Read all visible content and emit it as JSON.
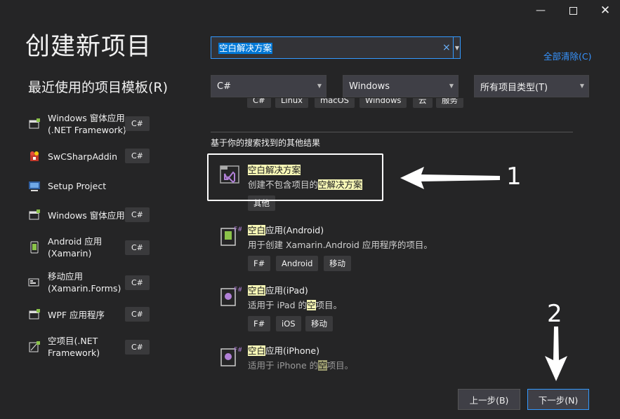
{
  "window": {
    "title": "创建新项目",
    "controls": [
      "minimize-icon",
      "maximize-icon",
      "close-icon"
    ]
  },
  "recent": {
    "header": "最近使用的项目模板(R)",
    "items": [
      {
        "label": "Windows 窗体应用 (.NET Framework)",
        "line1": "Windows 窗体应用",
        "line2": "(.NET Framework)",
        "lang": "C#",
        "icon": "winforms-icon"
      },
      {
        "label": "SwCSharpAddin",
        "line1": "SwCSharpAddin",
        "line2": "",
        "lang": "C#",
        "icon": "solidworks-addin-icon"
      },
      {
        "label": "Setup Project",
        "line1": "Setup Project",
        "line2": "",
        "lang": "",
        "icon": "setup-project-icon"
      },
      {
        "label": "Windows 窗体应用",
        "line1": "Windows 窗体应用",
        "line2": "",
        "lang": "C#",
        "icon": "winforms-icon"
      },
      {
        "label": "Android 应用 (Xamarin)",
        "line1": "Android 应用",
        "line2": "(Xamarin)",
        "lang": "C#",
        "icon": "android-app-icon"
      },
      {
        "label": "移动应用 (Xamarin.Forms)",
        "line1": "移动应用",
        "line2": "(Xamarin.Forms)",
        "lang": "C#",
        "icon": "mobile-app-icon"
      },
      {
        "label": "WPF 应用程序",
        "line1": "WPF 应用程序",
        "line2": "",
        "lang": "C#",
        "icon": "wpf-app-icon"
      },
      {
        "label": "空项目(.NET Framework)",
        "line1": "空项目(.NET",
        "line2": "Framework)",
        "lang": "C#",
        "icon": "empty-project-icon"
      }
    ]
  },
  "search": {
    "value": "空白解决方案",
    "clear_glyph": "×",
    "clear_all": "全部清除(C)"
  },
  "filters": {
    "language": "C#",
    "platform": "Windows",
    "project_type": "所有项目类型(T)"
  },
  "partial_tags": [
    "C#",
    "Linux",
    "macOS",
    "Windows",
    "云",
    "服务"
  ],
  "other_results_header": "基于你的搜索找到的其他结果",
  "results": [
    {
      "title_hl": "空白解决方案",
      "title_rest": "",
      "desc_pre": "创建不包含项目的",
      "desc_hl": "空解决方案",
      "desc_post": "",
      "tags": [
        "其他"
      ],
      "icon": "blank-solution-icon"
    },
    {
      "title_hl": "空白",
      "title_rest": "应用(Android)",
      "desc_pre": "用于创建 Xamarin.Android 应用程序的项目。",
      "desc_hl": "",
      "desc_post": "",
      "tags": [
        "F#",
        "Android",
        "移动"
      ],
      "icon": "android-blank-app-icon"
    },
    {
      "title_hl": "空白",
      "title_rest": "应用(iPad)",
      "desc_pre": "适用于 iPad 的",
      "desc_hl": "空",
      "desc_post": "项目。",
      "tags": [
        "F#",
        "iOS",
        "移动"
      ],
      "icon": "ipad-blank-app-icon"
    },
    {
      "title_hl": "空白",
      "title_rest": "应用(iPhone)",
      "desc_pre": "适用于 iPhone 的",
      "desc_hl": "空",
      "desc_post": "项目。",
      "tags": [],
      "icon": "iphone-blank-app-icon"
    }
  ],
  "annotations": {
    "one": "1",
    "two": "2"
  },
  "buttons": {
    "back": "上一步(B)",
    "next": "下一步(N)"
  },
  "colors": {
    "background": "#252526",
    "accent": "#3399ff",
    "highlight": "#f7f7b6",
    "vs_purple": "#b180d7"
  }
}
